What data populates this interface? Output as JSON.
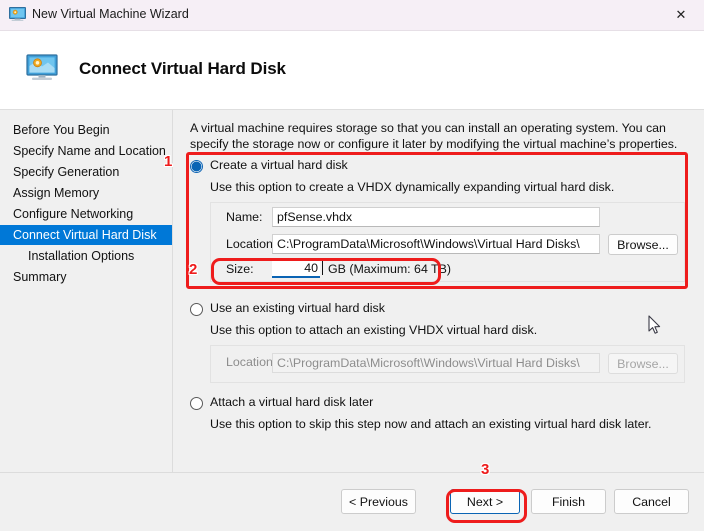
{
  "window": {
    "title": "New Virtual Machine Wizard",
    "icon": "virtual-machine-icon",
    "close_label": "✕"
  },
  "header": {
    "title": "Connect Virtual Hard Disk",
    "icon": "virtual-machine-icon"
  },
  "sidebar": {
    "items": [
      {
        "label": "Before You Begin",
        "selected": false,
        "indent": false
      },
      {
        "label": "Specify Name and Location",
        "selected": false,
        "indent": false
      },
      {
        "label": "Specify Generation",
        "selected": false,
        "indent": false
      },
      {
        "label": "Assign Memory",
        "selected": false,
        "indent": false
      },
      {
        "label": "Configure Networking",
        "selected": false,
        "indent": false
      },
      {
        "label": "Connect Virtual Hard Disk",
        "selected": true,
        "indent": false
      },
      {
        "label": "Installation Options",
        "selected": false,
        "indent": true
      },
      {
        "label": "Summary",
        "selected": false,
        "indent": false
      }
    ]
  },
  "main": {
    "intro": "A virtual machine requires storage so that you can install an operating system. You can specify the storage now or configure it later by modifying the virtual machine’s properties.",
    "option_create": {
      "label": "Create a virtual hard disk",
      "description": "Use this option to create a VHDX dynamically expanding virtual hard disk.",
      "selected": true,
      "name_label": "Name:",
      "name_value": "pfSense.vhdx",
      "location_label": "Location:",
      "location_value": "C:\\ProgramData\\Microsoft\\Windows\\Virtual Hard Disks\\",
      "browse_label": "Browse...",
      "size_label": "Size:",
      "size_value": "40",
      "size_suffix": "GB (Maximum: 64 TB)"
    },
    "option_existing": {
      "label": "Use an existing virtual hard disk",
      "description": "Use this option to attach an existing VHDX virtual hard disk.",
      "selected": false,
      "location_label": "Location:",
      "location_value": "C:\\ProgramData\\Microsoft\\Windows\\Virtual Hard Disks\\",
      "browse_label": "Browse..."
    },
    "option_later": {
      "label": "Attach a virtual hard disk later",
      "description": "Use this option to skip this step now and attach an existing virtual hard disk later.",
      "selected": false
    }
  },
  "footer": {
    "previous_label": "< Previous",
    "next_label": "Next >",
    "finish_label": "Finish",
    "cancel_label": "Cancel"
  },
  "annotations": {
    "marker_1": "1",
    "marker_2": "2",
    "marker_3": "3",
    "highlight_color": "#ee1c1c"
  }
}
